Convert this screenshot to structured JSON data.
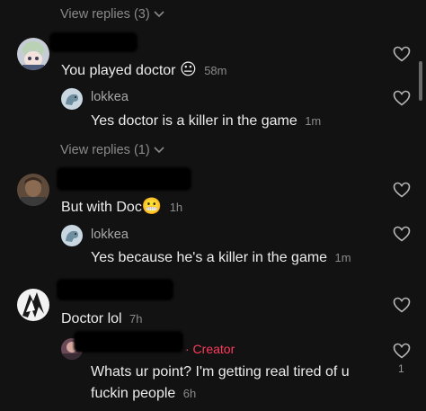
{
  "view_replies_top": "View replies (3)",
  "comments": [
    {
      "text": "You played doctor",
      "emoji": "😐",
      "time": "58m",
      "reply": {
        "username": "lokkea",
        "text": "Yes doctor is a killer in the game",
        "time": "1m"
      },
      "view_replies": "View replies (1)"
    },
    {
      "text": "But with Doc",
      "emoji": "😬",
      "time": "1h",
      "reply": {
        "username": "lokkea",
        "text": "Yes because he's a killer in the game",
        "time": "1m"
      }
    },
    {
      "text": "Doctor lol",
      "time": "7h",
      "reply": {
        "creator_label": "· Creator",
        "text_line1": "Whats ur point? I'm getting real tired of u",
        "text_line2": "fuckin people",
        "time": "6h",
        "like_count": "1"
      }
    }
  ],
  "colors": {
    "background": "#121212",
    "creator": "#ff3b5c",
    "muted": "#8a8a8a"
  }
}
